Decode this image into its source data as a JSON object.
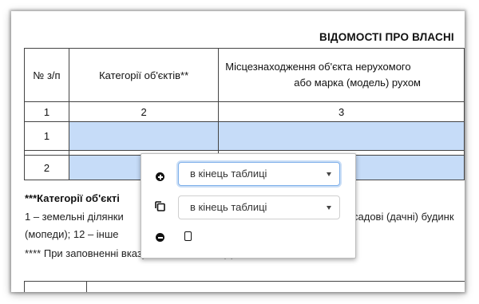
{
  "document": {
    "title": "ВІДОМОСТІ ПРО ВЛАСНІ",
    "table": {
      "headers": [
        "№ з/п",
        "Категорії об'єктів**",
        "Місцезнаходження об'єкта нерухомого",
        "або марка (модель) рухом"
      ],
      "column_numbers": [
        "1",
        "2",
        "3"
      ],
      "rows": [
        "1",
        "2"
      ]
    },
    "categories_title": "***Категорії об'єкті",
    "legend_lines": [
      "1 – земельні ділянки",
      "садові (дачні) будинк",
      "(мопеди); 12 – інше",
      "**** При заповненні вказується позначка (x)"
    ]
  },
  "popup": {
    "add_select_value": "в кінець таблиці",
    "copy_select_value": "в кінець таблиці"
  },
  "colors": {
    "highlight_cell": "#c6dcf8",
    "focus_border": "#7fb0ea"
  },
  "icons": [
    "plus-circle-icon",
    "copy-icon",
    "minus-circle-icon",
    "mobile-icon",
    "chevron-down-icon"
  ]
}
